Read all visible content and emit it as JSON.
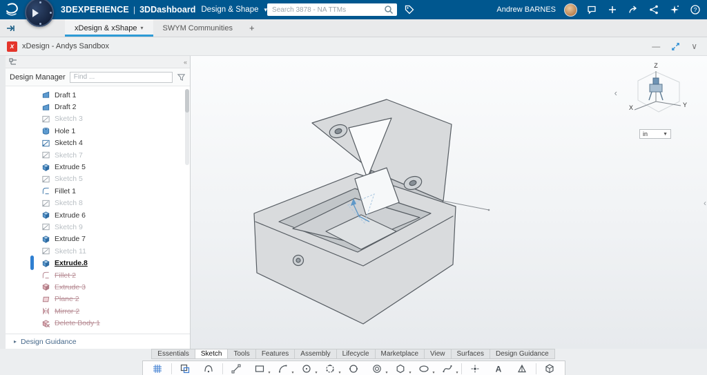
{
  "colors": {
    "topbar_bg": "#00578f",
    "accent": "#2e9bd6",
    "selection": "#2f7fd1",
    "app_icon": "#e4352b"
  },
  "topbar": {
    "brand": "3DEXPERIENCE",
    "pipe": "|",
    "app": "3DDashboard",
    "context": "Design & Shape",
    "context_caret": "▾",
    "search": {
      "placeholder": "Search 3878 - NA TTMs"
    },
    "user": "Andrew BARNES",
    "icons": [
      "notifications",
      "add",
      "share",
      "social",
      "assistant",
      "help"
    ]
  },
  "tabbar": {
    "tabs": [
      {
        "label": "xDesign & xShape",
        "active": true,
        "caret": "▾"
      },
      {
        "label": "SWYM Communities",
        "active": false
      }
    ],
    "add_label": "+"
  },
  "window": {
    "title": "xDesign - Andys Sandbox",
    "minimize": "—",
    "chevron": "∨"
  },
  "panel": {
    "collapse": "«",
    "title": "Design Manager",
    "find_placeholder": "Find ...",
    "tree": [
      {
        "label": "Draft 1",
        "icon": "draft",
        "state": "normal"
      },
      {
        "label": "Draft 2",
        "icon": "draft",
        "state": "normal"
      },
      {
        "label": "Sketch 3",
        "icon": "sketch",
        "state": "dim"
      },
      {
        "label": "Hole 1",
        "icon": "hole",
        "state": "normal"
      },
      {
        "label": "Sketch 4",
        "icon": "sketch",
        "state": "normal"
      },
      {
        "label": "Sketch 7",
        "icon": "sketch",
        "state": "dim"
      },
      {
        "label": "Extrude 5",
        "icon": "extrude",
        "state": "normal"
      },
      {
        "label": "Sketch 5",
        "icon": "sketch",
        "state": "dim"
      },
      {
        "label": "Fillet 1",
        "icon": "fillet",
        "state": "normal"
      },
      {
        "label": "Sketch 8",
        "icon": "sketch",
        "state": "dim"
      },
      {
        "label": "Extrude 6",
        "icon": "extrude",
        "state": "normal"
      },
      {
        "label": "Sketch 9",
        "icon": "sketch",
        "state": "dim"
      },
      {
        "label": "Extrude 7",
        "icon": "extrude",
        "state": "normal"
      },
      {
        "label": "Sketch 11",
        "icon": "sketch",
        "state": "dim"
      },
      {
        "label": "Extrude.8",
        "icon": "extrude",
        "state": "selected"
      },
      {
        "label": "Fillet 2",
        "icon": "fillet",
        "state": "struck"
      },
      {
        "label": "Extrude 3",
        "icon": "extrude",
        "state": "struck"
      },
      {
        "label": "Plane 2",
        "icon": "plane",
        "state": "struck"
      },
      {
        "label": "Mirror 2",
        "icon": "mirror",
        "state": "struck"
      },
      {
        "label": "Delete Body 1",
        "icon": "delete-body",
        "state": "struck"
      }
    ],
    "footer": "Design Guidance",
    "footer_caret": "▸"
  },
  "viewport": {
    "axes": {
      "x": "X",
      "y": "Y",
      "z": "Z"
    },
    "units": "in",
    "units_caret": "▼",
    "left_chevron": "‹",
    "edge_chevron": "‹"
  },
  "ribbon": {
    "active_tab": "Sketch",
    "tabs": [
      "Essentials",
      "Sketch",
      "Tools",
      "Features",
      "Assembly",
      "Lifecycle",
      "Marketplace",
      "View",
      "Surfaces",
      "Design Guidance"
    ]
  },
  "sketch_toolbar": {
    "tools": [
      {
        "name": "sketch-grid",
        "dropdown": false,
        "sep_after": true
      },
      {
        "name": "convert-entities",
        "dropdown": false
      },
      {
        "name": "silhouette",
        "dropdown": false,
        "sep_after": true
      },
      {
        "name": "line",
        "dropdown": false
      },
      {
        "name": "rectangle",
        "dropdown": true
      },
      {
        "name": "arc",
        "dropdown": true
      },
      {
        "name": "circle",
        "dropdown": true
      },
      {
        "name": "three-point-circle",
        "dropdown": true
      },
      {
        "name": "perimeter-circle",
        "dropdown": false
      },
      {
        "name": "concentric-circle",
        "dropdown": true
      },
      {
        "name": "polygon",
        "dropdown": true
      },
      {
        "name": "ellipse",
        "dropdown": true
      },
      {
        "name": "spline",
        "dropdown": true,
        "sep_after": true
      },
      {
        "name": "point",
        "dropdown": false
      },
      {
        "name": "text",
        "dropdown": false
      },
      {
        "name": "constraint",
        "dropdown": false,
        "sep_after": true
      },
      {
        "name": "exit-sketch",
        "dropdown": false
      }
    ]
  }
}
